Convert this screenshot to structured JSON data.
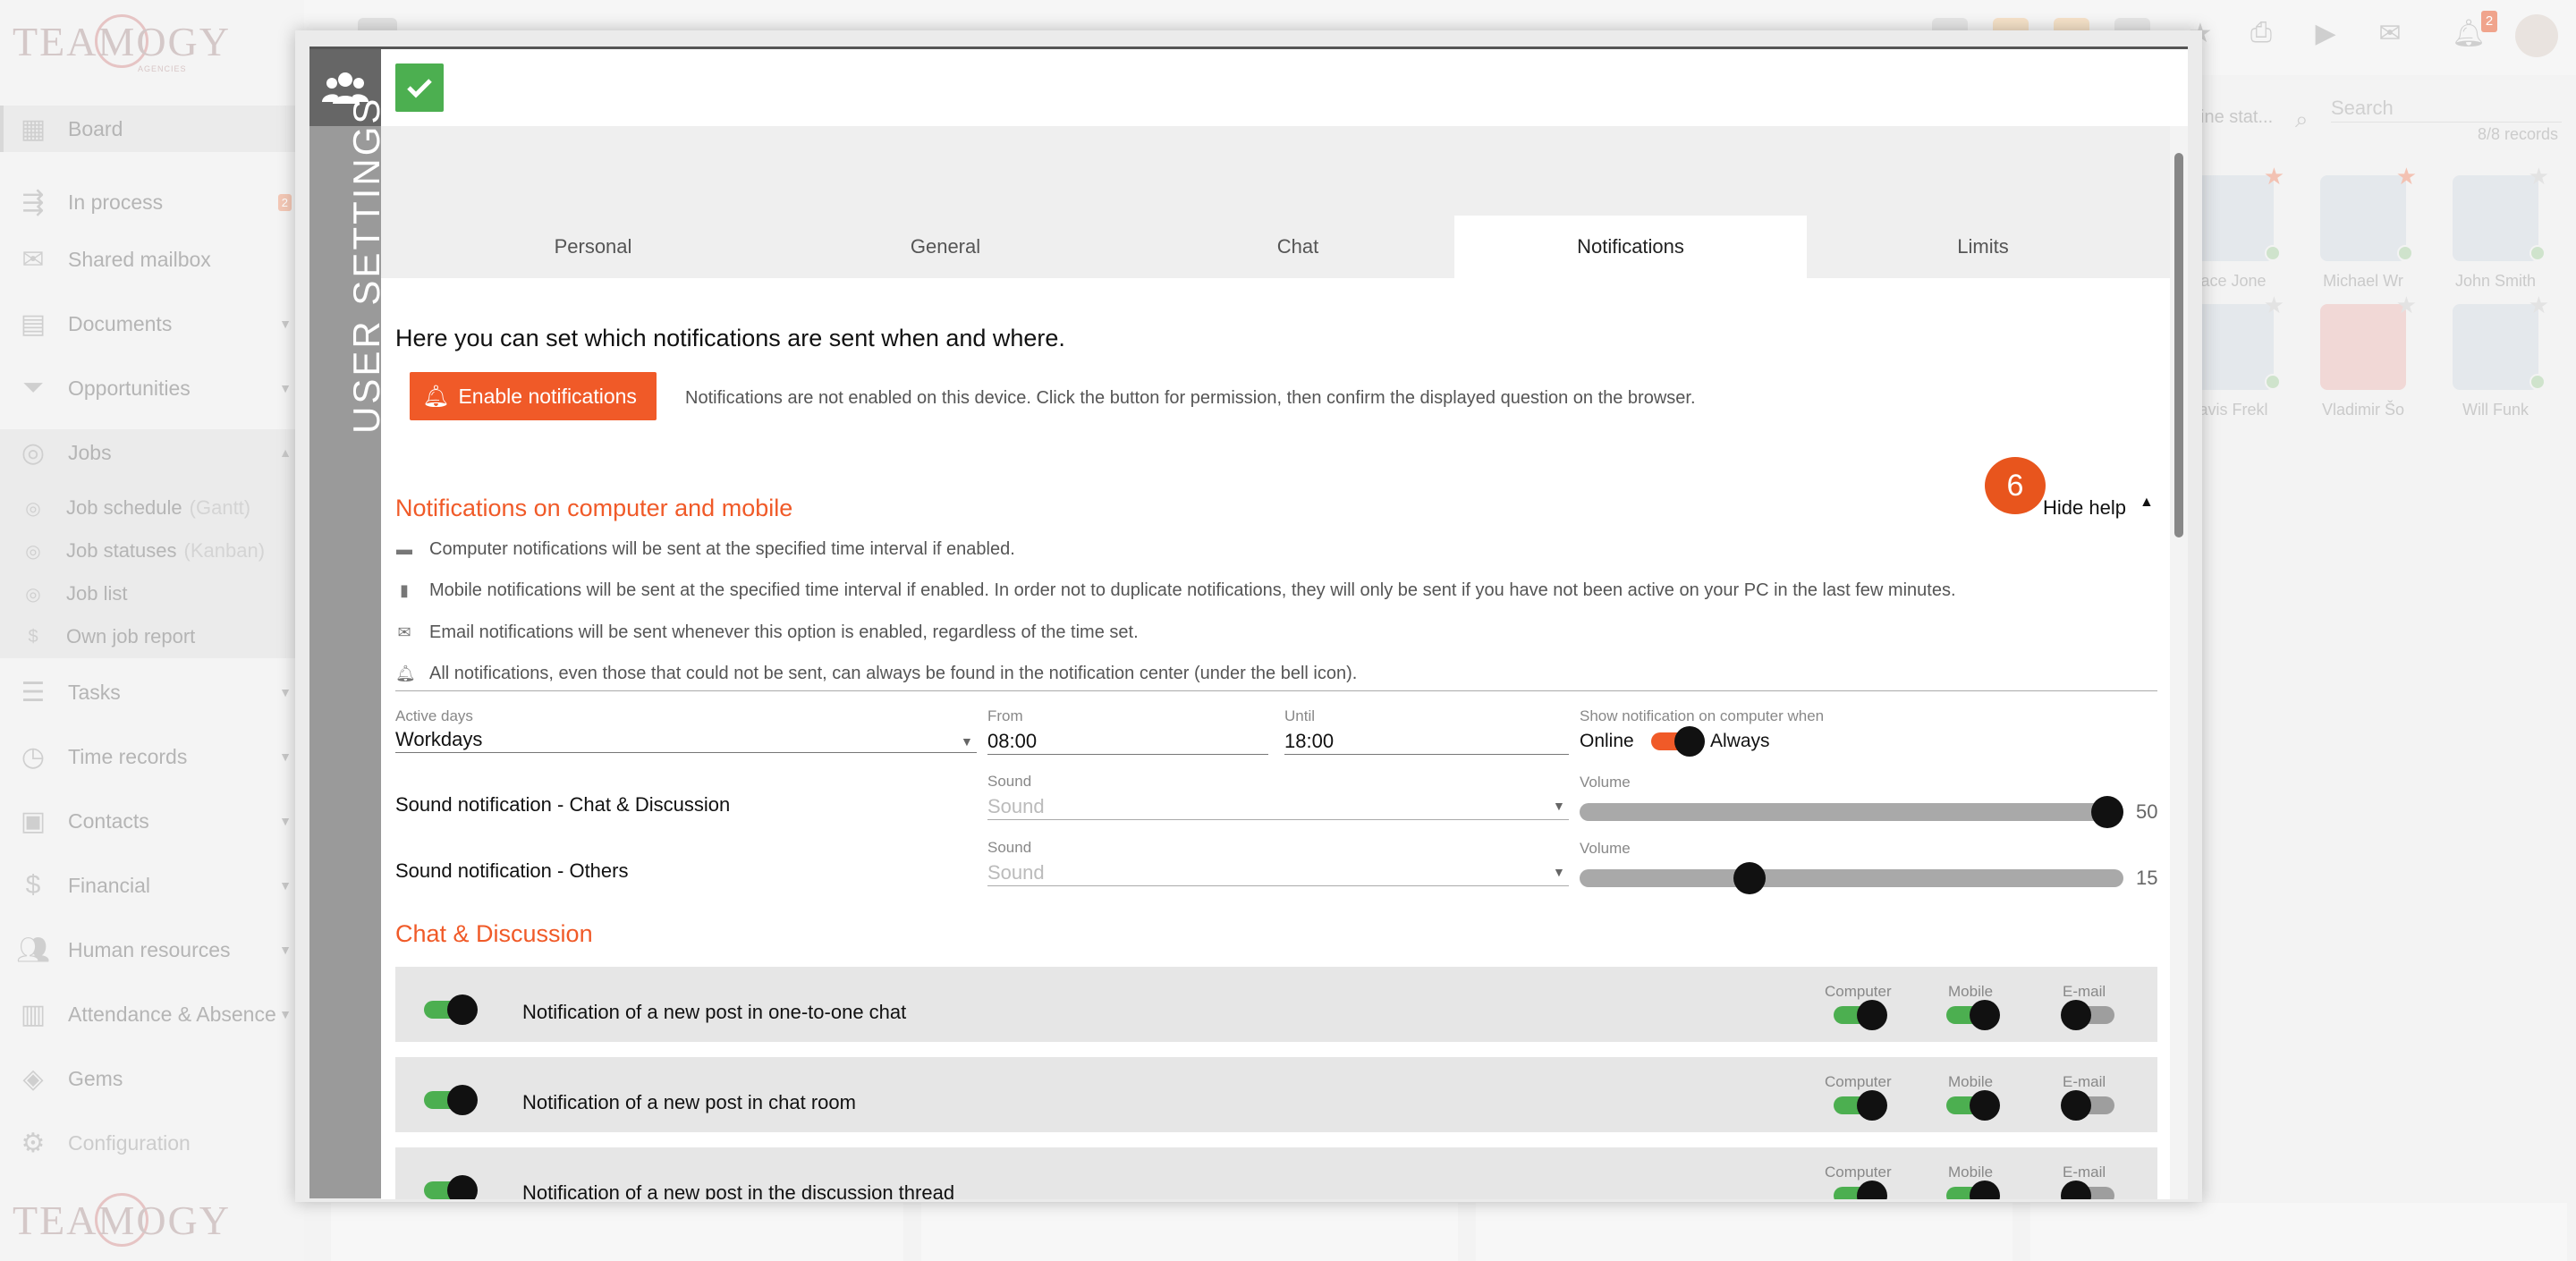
{
  "background": {
    "sidebar": {
      "items": [
        {
          "label": "Board",
          "icon": "grid-icon"
        },
        {
          "label": "In process",
          "icon": "process-icon",
          "badge": "2"
        },
        {
          "label": "Shared mailbox",
          "icon": "envelope-icon"
        },
        {
          "label": "Documents",
          "icon": "document-icon"
        },
        {
          "label": "Opportunities",
          "icon": "funnel-icon"
        },
        {
          "label": "Jobs",
          "icon": "target-icon"
        },
        {
          "label": "Job schedule",
          "extra": "(Gantt)",
          "icon": "target-small-icon"
        },
        {
          "label": "Job statuses",
          "extra": "(Kanban)",
          "icon": "target-small-icon"
        },
        {
          "label": "Job list",
          "icon": "target-small-icon"
        },
        {
          "label": "Own job report",
          "icon": "dollar-small-icon"
        },
        {
          "label": "Tasks",
          "icon": "tasks-icon"
        },
        {
          "label": "Time records",
          "icon": "clock-icon"
        },
        {
          "label": "Contacts",
          "icon": "contacts-icon"
        },
        {
          "label": "Financial",
          "icon": "dollar-icon"
        },
        {
          "label": "Human resources",
          "icon": "people-icon"
        },
        {
          "label": "Attendance & Absence",
          "icon": "building-icon"
        },
        {
          "label": "Gems",
          "icon": "gem-icon"
        },
        {
          "label": "Configuration",
          "icon": "gear-icon"
        }
      ]
    },
    "right_panel": {
      "stat_text": "ine stat...",
      "search_placeholder": "Search",
      "records": "8/8 records",
      "people": [
        {
          "name": "race Jone"
        },
        {
          "name": "Michael Wr"
        },
        {
          "name": "John Smith"
        },
        {
          "name": "ravis Frekl"
        },
        {
          "name": "Vladimir Šo"
        },
        {
          "name": "Will Funk"
        }
      ]
    },
    "bell_badge": "2"
  },
  "modal": {
    "side_title": "USER SETTINGS",
    "tabs": [
      {
        "label": "Personal",
        "active": false
      },
      {
        "label": "General",
        "active": false
      },
      {
        "label": "Chat",
        "active": false
      },
      {
        "label": "Notifications",
        "active": true
      },
      {
        "label": "Limits",
        "active": false
      }
    ],
    "intro": "Here you can set which notifications are sent when and where.",
    "enable_button": "Enable notifications",
    "enable_message": "Notifications are not enabled on this device. Click the button for permission, then confirm the displayed question on the browser.",
    "section_computer": "Notifications on computer and mobile",
    "help_badge": "6",
    "hide_help": "Hide help",
    "help_lines": [
      {
        "icon": "monitor-icon",
        "text": "Computer notifications will be sent at the specified time interval if enabled."
      },
      {
        "icon": "mobile-icon",
        "text": "Mobile notifications will be sent at the specified time interval if enabled. In order not to duplicate notifications, they will only be sent if you have not been active on your PC in the last few minutes."
      },
      {
        "icon": "envelope-icon",
        "text": "Email notifications will be sent whenever this option is enabled, regardless of the time set."
      },
      {
        "icon": "bell-icon",
        "text": "All notifications, even those that could not be sent, can always be found in the notification center (under the bell icon)."
      }
    ],
    "active_days": {
      "label": "Active days",
      "value": "Workdays"
    },
    "from": {
      "label": "From",
      "value": "08:00"
    },
    "until": {
      "label": "Until",
      "value": "18:00"
    },
    "show_when": {
      "label": "Show notification on computer when",
      "left": "Online",
      "right": "Always",
      "state": "Always"
    },
    "sound_chat": {
      "label": "Sound notification - Chat & Discussion",
      "sound_label": "Sound",
      "sound_placeholder": "Sound",
      "volume_label": "Volume",
      "volume": 50,
      "volume_text": "50"
    },
    "sound_others": {
      "label": "Sound notification - Others",
      "sound_label": "Sound",
      "sound_placeholder": "Sound",
      "volume_label": "Volume",
      "volume": 15,
      "volume_text": "15"
    },
    "section_chat": "Chat & Discussion",
    "chat_columns": [
      "Computer",
      "Mobile",
      "E-mail"
    ],
    "chat_rows": [
      {
        "text": "Notification of a new post in one-to-one chat",
        "enabled": true,
        "computer": true,
        "mobile": true,
        "email": false
      },
      {
        "text": "Notification of a new post in chat room",
        "enabled": true,
        "computer": true,
        "mobile": true,
        "email": false
      },
      {
        "text": "Notification of a new post in the discussion thread",
        "enabled": true,
        "computer": true,
        "mobile": true,
        "email": false
      }
    ],
    "colors": {
      "accent": "#f05a28",
      "green": "#4caf50"
    }
  }
}
